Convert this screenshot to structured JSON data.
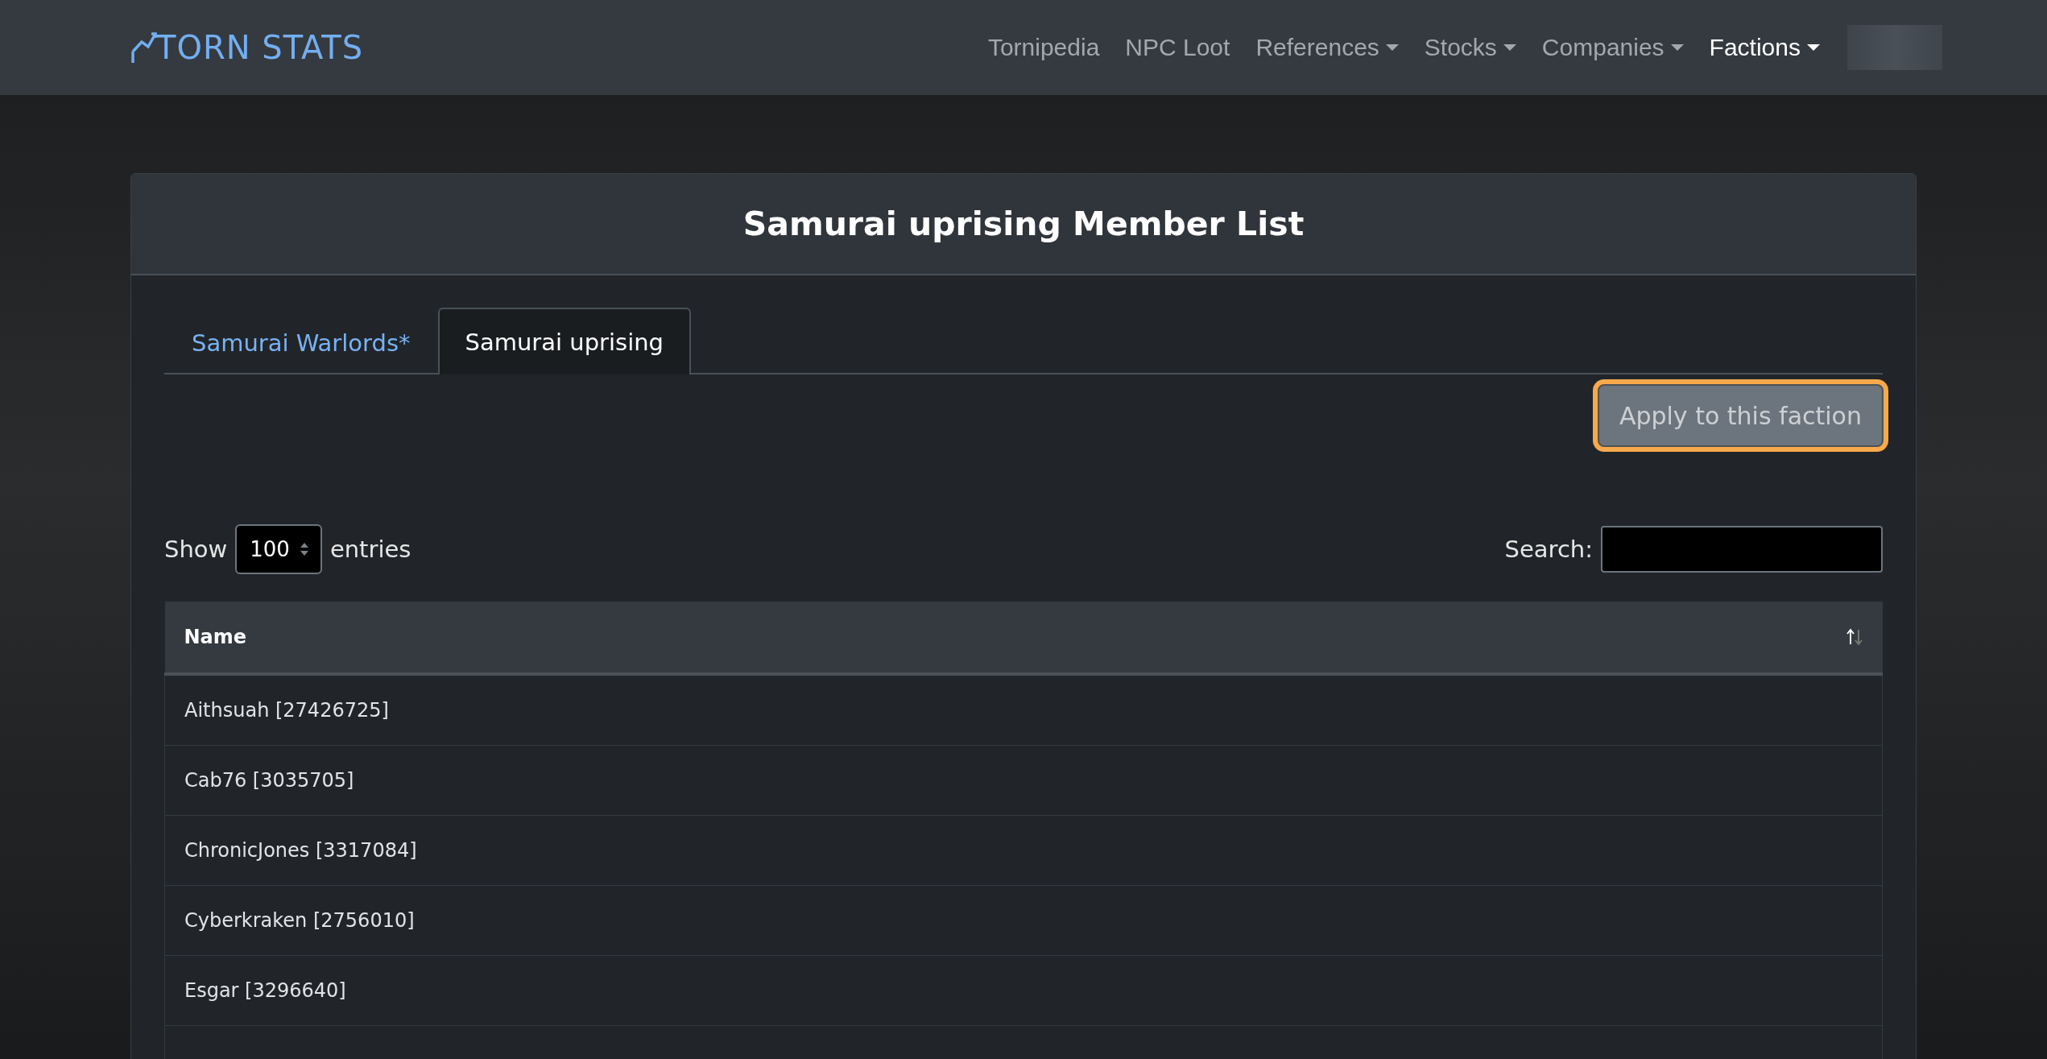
{
  "navbar": {
    "logo": "TORN STATS",
    "links": [
      {
        "label": "Tornipedia",
        "dropdown": false,
        "selected": false
      },
      {
        "label": "NPC Loot",
        "dropdown": false,
        "selected": false
      },
      {
        "label": "References",
        "dropdown": true,
        "selected": false
      },
      {
        "label": "Stocks",
        "dropdown": true,
        "selected": false
      },
      {
        "label": "Companies",
        "dropdown": true,
        "selected": false
      },
      {
        "label": "Factions",
        "dropdown": true,
        "selected": true
      }
    ]
  },
  "card": {
    "title": "Samurai uprising Member List",
    "tabs": [
      {
        "label": "Samurai Warlords*",
        "selected": false
      },
      {
        "label": "Samurai uprising",
        "selected": true
      }
    ],
    "apply_button": {
      "label": "Apply to this faction",
      "focused": true
    },
    "length": {
      "before": "Show",
      "value": "100",
      "after": "entries"
    },
    "search": {
      "label": "Search:"
    },
    "table": {
      "columns": [
        {
          "label": "Name"
        }
      ],
      "rows": [
        {
          "name": "Aithsuah [27426725]"
        },
        {
          "name": "Cab76 [3035705]"
        },
        {
          "name": "ChronicJones [3317084]"
        },
        {
          "name": "Cyberkraken [2756010]"
        },
        {
          "name": "Esgar [3296640]"
        }
      ]
    }
  }
}
